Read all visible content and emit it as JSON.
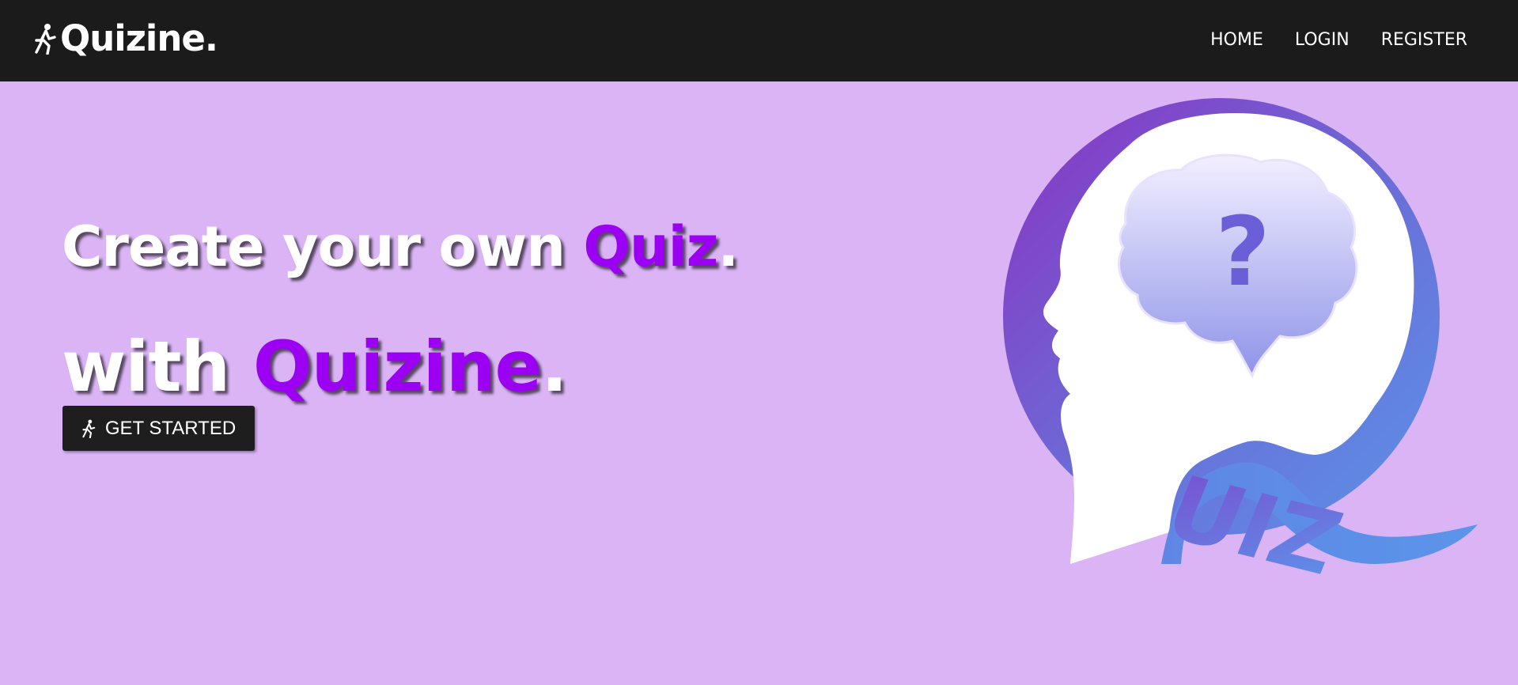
{
  "nav": {
    "brand": "Quizine.",
    "brand_icon": "running-person-icon",
    "links": [
      "HOME",
      "LOGIN",
      "REGISTER"
    ]
  },
  "hero": {
    "line1": {
      "text": "Create your own ",
      "accent": "Quiz",
      "end": "."
    },
    "line2": {
      "text": "with ",
      "accent": "Quizine",
      "end": "."
    },
    "cta_label": "GET STARTED",
    "cta_icon": "running-person-icon",
    "logo_text": "UIZ",
    "logo_symbol": "?"
  },
  "colors": {
    "background": "#dab4f5",
    "navbar": "#1b1b1b",
    "accent": "#9b00f3",
    "button": "#1e1e1e",
    "logo_purple": "#7b3fc4",
    "logo_blue": "#5b8be6"
  }
}
